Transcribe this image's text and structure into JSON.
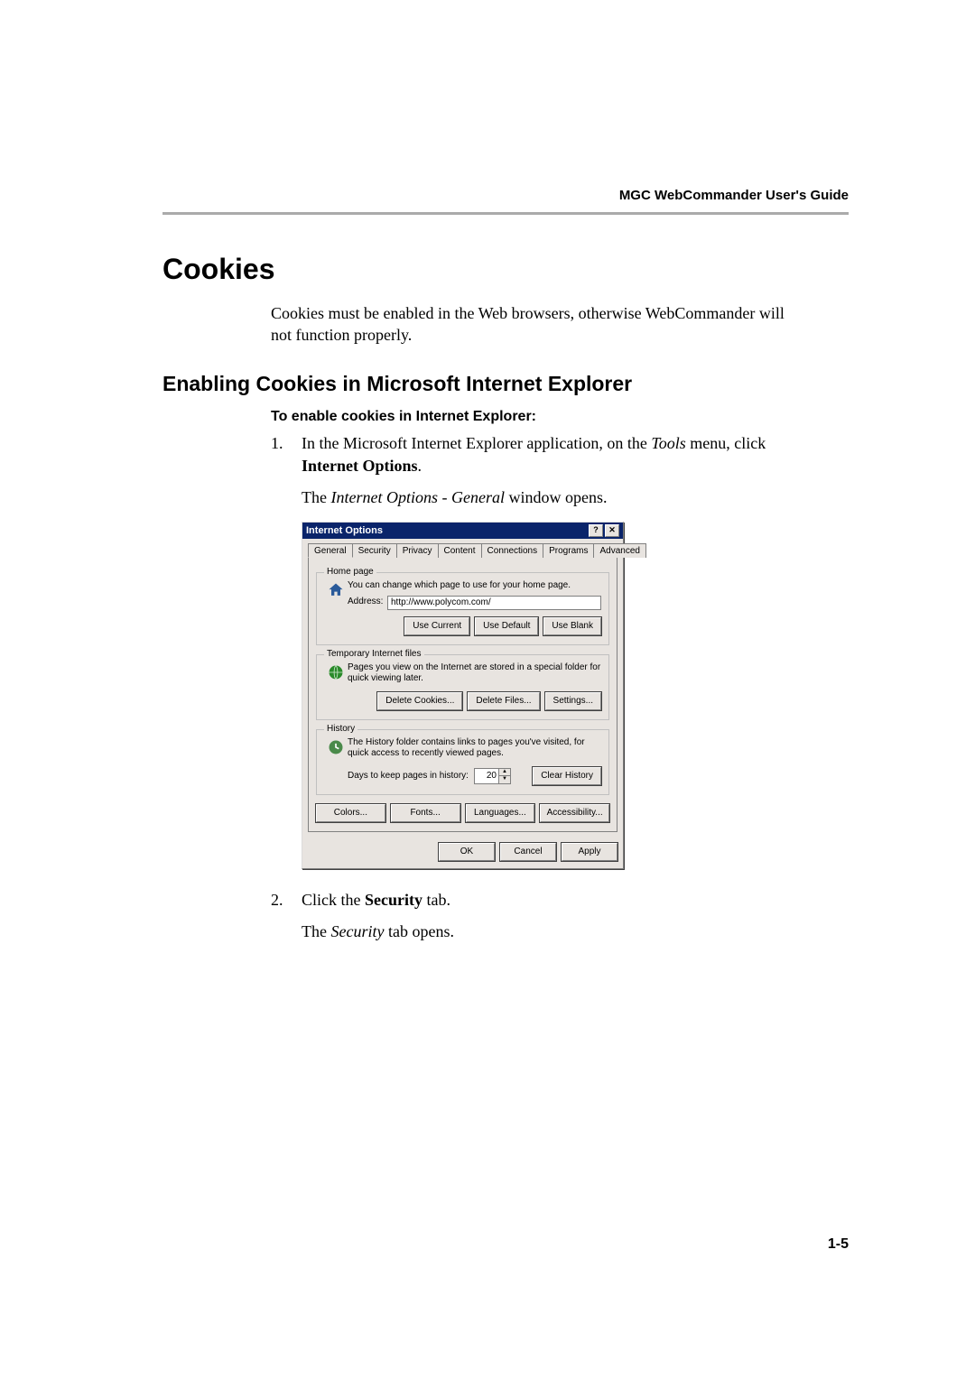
{
  "header": {
    "running": "MGC WebCommander User's Guide"
  },
  "h1": "Cookies",
  "intro": "Cookies must be enabled in the Web browsers, otherwise WebCommander will not function properly.",
  "h2": "Enabling Cookies in Microsoft Internet Explorer",
  "procedure_title": "To enable cookies in Internet Explorer:",
  "steps": {
    "s1": {
      "num": "1.",
      "pre": "In the Microsoft Internet Explorer application, on the ",
      "italic1": "Tools",
      "mid": " menu, click ",
      "bold1": "Internet Options",
      "post": ".",
      "follow_pre": "The ",
      "follow_italic": "Internet Options - General",
      "follow_post": " window opens."
    },
    "s2": {
      "num": "2.",
      "pre": "Click the ",
      "bold1": "Security",
      "post": " tab.",
      "follow_pre": "The ",
      "follow_italic": "Security",
      "follow_post": " tab opens."
    }
  },
  "dialog": {
    "title": "Internet Options",
    "help_btn": "?",
    "close_btn": "✕",
    "tabs": [
      "General",
      "Security",
      "Privacy",
      "Content",
      "Connections",
      "Programs",
      "Advanced"
    ],
    "active_tab": "General",
    "home": {
      "legend": "Home page",
      "text": "You can change which page to use for your home page.",
      "address_label": "Address:",
      "address_value": "http://www.polycom.com/",
      "btn_current": "Use Current",
      "btn_default": "Use Default",
      "btn_blank": "Use Blank"
    },
    "temp": {
      "legend": "Temporary Internet files",
      "text": "Pages you view on the Internet are stored in a special folder for quick viewing later.",
      "btn_cookies": "Delete Cookies...",
      "btn_files": "Delete Files...",
      "btn_settings": "Settings..."
    },
    "history": {
      "legend": "History",
      "text": "The History folder contains links to pages you've visited, for quick access to recently viewed pages.",
      "days_label": "Days to keep pages in history:",
      "days_value": "20",
      "btn_clear": "Clear History"
    },
    "bottom": {
      "colors": "Colors...",
      "fonts": "Fonts...",
      "languages": "Languages...",
      "accessibility": "Accessibility..."
    },
    "footer": {
      "ok": "OK",
      "cancel": "Cancel",
      "apply": "Apply"
    }
  },
  "page_number": "1-5"
}
